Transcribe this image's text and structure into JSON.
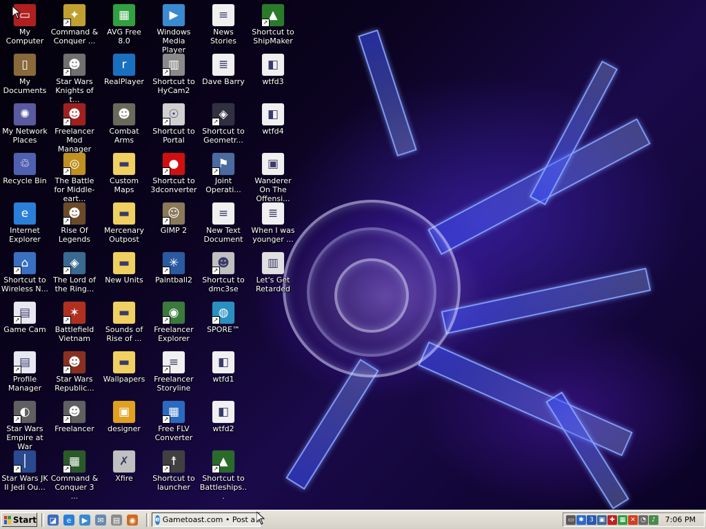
{
  "desktop": {
    "icons": [
      {
        "label": "My Computer",
        "icon": "my-computer-icon",
        "color": "#b02020",
        "glyph": "▭",
        "shortcut": false
      },
      {
        "label": "My Documents",
        "icon": "my-documents-icon",
        "color": "#8a6a3a",
        "glyph": "▯",
        "shortcut": false
      },
      {
        "label": "My Network Places",
        "icon": "network-places-icon",
        "color": "#5a5aa0",
        "glyph": "✺",
        "shortcut": false
      },
      {
        "label": "Recycle Bin",
        "icon": "recycle-bin-icon",
        "color": "#5060b0",
        "glyph": "♲",
        "shortcut": false
      },
      {
        "label": "Internet Explorer",
        "icon": "internet-explorer-icon",
        "color": "#2a7fd8",
        "glyph": "e",
        "shortcut": false
      },
      {
        "label": "Shortcut to Wireless N...",
        "icon": "wireless-network-icon",
        "color": "#3a70c0",
        "glyph": "⌂",
        "shortcut": true
      },
      {
        "label": "Game Cam",
        "icon": "game-cam-icon",
        "color": "#e8e8f0",
        "glyph": "▤",
        "shortcut": true
      },
      {
        "label": "Profile Manager",
        "icon": "profile-manager-icon",
        "color": "#e8e8f0",
        "glyph": "▤",
        "shortcut": true
      },
      {
        "label": "Star Wars Empire at War",
        "icon": "star-wars-eaw-icon",
        "color": "#606060",
        "glyph": "◐",
        "shortcut": true
      },
      {
        "label": "Star Wars JK II Jedi Ou...",
        "icon": "jedi-outcast-icon",
        "color": "#2a4a90",
        "glyph": "│",
        "shortcut": true
      },
      {
        "label": "Command & Conquer ...",
        "icon": "command-conquer-icon",
        "color": "#c0a030",
        "glyph": "✦",
        "shortcut": true
      },
      {
        "label": "Star Wars Knights of t...",
        "icon": "kotor-icon",
        "color": "#707070",
        "glyph": "☻",
        "shortcut": true
      },
      {
        "label": "Freelancer Mod Manager",
        "icon": "freelancer-mod-manager-icon",
        "color": "#a02020",
        "glyph": "☻",
        "shortcut": true
      },
      {
        "label": "The Battle for Middle-eart...",
        "icon": "battle-middle-earth-icon",
        "color": "#c09020",
        "glyph": "◎",
        "shortcut": true
      },
      {
        "label": "Rise Of Legends",
        "icon": "rise-of-legends-icon",
        "color": "#6a4a2a",
        "glyph": "☻",
        "shortcut": true
      },
      {
        "label": "The Lord of the Ring...",
        "icon": "lotr-icon",
        "color": "#3a6a90",
        "glyph": "◈",
        "shortcut": true
      },
      {
        "label": "Battlefield Vietnam",
        "icon": "battlefield-vietnam-icon",
        "color": "#b03020",
        "glyph": "✶",
        "shortcut": true
      },
      {
        "label": "Star Wars Republic...",
        "icon": "republic-commando-icon",
        "color": "#8a3020",
        "glyph": "☻",
        "shortcut": true
      },
      {
        "label": "Freelancer",
        "icon": "freelancer-icon",
        "color": "#606060",
        "glyph": "☻",
        "shortcut": true
      },
      {
        "label": "Command & Conquer 3 ...",
        "icon": "cnc3-icon",
        "color": "#2a5a2a",
        "glyph": "▦",
        "shortcut": true
      },
      {
        "label": "AVG Free 8.0",
        "icon": "avg-icon",
        "color": "#30a040",
        "glyph": "▦",
        "shortcut": false
      },
      {
        "label": "RealPlayer",
        "icon": "realplayer-icon",
        "color": "#1a70c0",
        "glyph": "r",
        "shortcut": false
      },
      {
        "label": "Combat Arms",
        "icon": "combat-arms-icon",
        "color": "#6a6a5a",
        "glyph": "☻",
        "shortcut": false
      },
      {
        "label": "Custom Maps",
        "icon": "folder-icon",
        "color": "#f0d060",
        "glyph": "▬",
        "shortcut": false
      },
      {
        "label": "Mercenary Outpost",
        "icon": "folder-icon",
        "color": "#f0d060",
        "glyph": "▬",
        "shortcut": false
      },
      {
        "label": "New Units",
        "icon": "folder-icon",
        "color": "#f0d060",
        "glyph": "▬",
        "shortcut": false
      },
      {
        "label": "Sounds of Rise of ...",
        "icon": "folder-icon",
        "color": "#f0d060",
        "glyph": "▬",
        "shortcut": false
      },
      {
        "label": "Wallpapers",
        "icon": "folder-icon",
        "color": "#f0d060",
        "glyph": "▬",
        "shortcut": false
      },
      {
        "label": "designer",
        "icon": "designer-icon",
        "color": "#e0a020",
        "glyph": "▣",
        "shortcut": false
      },
      {
        "label": "Xfire",
        "icon": "xfire-icon",
        "color": "#c0c0c0",
        "glyph": "✗",
        "shortcut": false
      },
      {
        "label": "Windows Media Player",
        "icon": "media-player-icon",
        "color": "#3a8ad0",
        "glyph": "▶",
        "shortcut": false
      },
      {
        "label": "Shortcut to HyCam2",
        "icon": "hycam-icon",
        "color": "#8a8a8a",
        "glyph": "▥",
        "shortcut": true
      },
      {
        "label": "Shortcut to Portal",
        "icon": "portal-icon",
        "color": "#d0d0d0",
        "glyph": "☉",
        "shortcut": true
      },
      {
        "label": "Shortcut to 3dconverter",
        "icon": "3dconverter-icon",
        "color": "#d01010",
        "glyph": "●",
        "shortcut": true
      },
      {
        "label": "GIMP 2",
        "icon": "gimp-icon",
        "color": "#8a7a5a",
        "glyph": "☺",
        "shortcut": true
      },
      {
        "label": "Paintball2",
        "icon": "paintball-icon",
        "color": "#2a5aa0",
        "glyph": "✳",
        "shortcut": true
      },
      {
        "label": "Freelancer Explorer",
        "icon": "freelancer-explorer-icon",
        "color": "#3a7a3a",
        "glyph": "◉",
        "shortcut": true
      },
      {
        "label": "Freelancer Storyline",
        "icon": "text-document-icon",
        "color": "#f0f0f0",
        "glyph": "≡",
        "shortcut": true
      },
      {
        "label": "Free FLV Converter",
        "icon": "flv-converter-icon",
        "color": "#2a6ac0",
        "glyph": "▦",
        "shortcut": true
      },
      {
        "label": "Shortcut to launcher",
        "icon": "launcher-icon",
        "color": "#404040",
        "glyph": "☨",
        "shortcut": true
      },
      {
        "label": "News Stories",
        "icon": "text-document-icon",
        "color": "#f0f0f0",
        "glyph": "≡",
        "shortcut": false
      },
      {
        "label": "Dave Barry",
        "icon": "word-document-icon",
        "color": "#f0f0f0",
        "glyph": "≣",
        "shortcut": false
      },
      {
        "label": "Shortcut to Geometr...",
        "icon": "geometry-wars-icon",
        "color": "#303040",
        "glyph": "◈",
        "shortcut": true
      },
      {
        "label": "Joint Operati...",
        "icon": "joint-operations-icon",
        "color": "#4a6aa0",
        "glyph": "⚑",
        "shortcut": true
      },
      {
        "label": "New Text Document",
        "icon": "text-document-icon",
        "color": "#f0f0f0",
        "glyph": "≡",
        "shortcut": false
      },
      {
        "label": "Shortcut to dmc3se",
        "icon": "dmc3-icon",
        "color": "#c0c0c0",
        "glyph": "☻",
        "shortcut": true
      },
      {
        "label": "SPORE™",
        "icon": "spore-icon",
        "color": "#2a90c0",
        "glyph": "◍",
        "shortcut": true
      },
      {
        "label": "wtfd1",
        "icon": "web-document-icon",
        "color": "#f0f0f0",
        "glyph": "◧",
        "shortcut": false
      },
      {
        "label": "wtfd2",
        "icon": "web-document-icon",
        "color": "#f0f0f0",
        "glyph": "◧",
        "shortcut": false
      },
      {
        "label": "Shortcut to Battleships...",
        "icon": "battleships-icon",
        "color": "#2a6a2a",
        "glyph": "▲",
        "shortcut": true
      },
      {
        "label": "Shortcut to ShipMaker",
        "icon": "shipmaker-icon",
        "color": "#2a7a2a",
        "glyph": "▲",
        "shortcut": true
      },
      {
        "label": "wtfd3",
        "icon": "web-document-icon",
        "color": "#f0f0f0",
        "glyph": "◧",
        "shortcut": false
      },
      {
        "label": "wtfd4",
        "icon": "web-document-icon",
        "color": "#f0f0f0",
        "glyph": "◧",
        "shortcut": false
      },
      {
        "label": "Wanderer On The Offensi...",
        "icon": "video-file-icon",
        "color": "#f0f0f0",
        "glyph": "▣",
        "shortcut": false
      },
      {
        "label": "When I was younger ...",
        "icon": "word-document-icon",
        "color": "#f0f0f0",
        "glyph": "≣",
        "shortcut": false
      },
      {
        "label": "Let's Get Retarded",
        "icon": "audio-file-icon",
        "color": "#e0e0e0",
        "glyph": "▥",
        "shortcut": false
      }
    ]
  },
  "taskbar": {
    "start_label": "Start",
    "quick_launch": [
      {
        "icon": "show-desktop-icon",
        "color": "#3a6ac0",
        "glyph": "◪"
      },
      {
        "icon": "internet-explorer-icon",
        "color": "#2a7fd8",
        "glyph": "e"
      },
      {
        "icon": "media-player-icon",
        "color": "#3a8ad0",
        "glyph": "▶"
      },
      {
        "icon": "outlook-icon",
        "color": "#6a8ab0",
        "glyph": "✉"
      },
      {
        "icon": "network-icon",
        "color": "#8a8a8a",
        "glyph": "▤"
      },
      {
        "icon": "firefox-icon",
        "color": "#d06a20",
        "glyph": "◉"
      }
    ],
    "task": {
      "label": "Gametoast.com • Post a ..."
    },
    "tray_icons": [
      {
        "icon": "tray-safely-remove-icon",
        "color": "#5a5a5a",
        "glyph": "▭"
      },
      {
        "icon": "tray-bluetooth-icon",
        "color": "#2a6ad0",
        "glyph": "✱"
      },
      {
        "icon": "tray-3d-icon",
        "color": "#2a5ab0",
        "glyph": "3"
      },
      {
        "icon": "tray-monitor-icon",
        "color": "#3a6aa0",
        "glyph": "▣"
      },
      {
        "icon": "tray-security-icon",
        "color": "#c02020",
        "glyph": "✚"
      },
      {
        "icon": "tray-avg-icon",
        "color": "#30a040",
        "glyph": "▦"
      },
      {
        "icon": "tray-wireless-icon",
        "color": "#d04020",
        "glyph": "✕"
      },
      {
        "icon": "tray-volume-icon",
        "color": "#6a6a6a",
        "glyph": "◔"
      },
      {
        "icon": "tray-speaker-icon",
        "color": "#4a8a4a",
        "glyph": "♪"
      }
    ],
    "clock": "7:06 PM"
  }
}
